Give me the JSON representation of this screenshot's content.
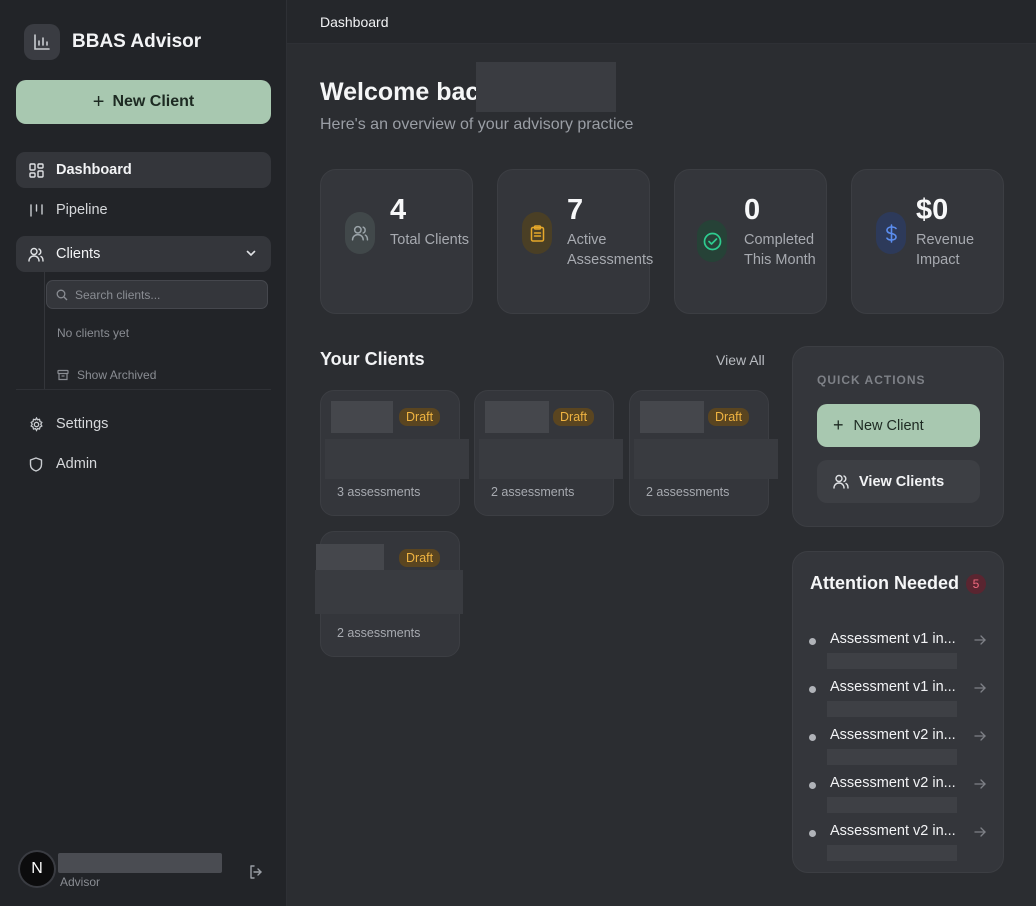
{
  "app": {
    "name": "BBAS Advisor"
  },
  "sidebar": {
    "new_client_label": "New Client",
    "nav": {
      "dashboard": "Dashboard",
      "pipeline": "Pipeline",
      "clients": "Clients",
      "settings": "Settings",
      "admin": "Admin"
    },
    "clients_panel": {
      "search_placeholder": "Search clients...",
      "empty_text": "No clients yet",
      "show_archived": "Show Archived"
    },
    "user": {
      "avatar_initial": "N",
      "role": "Advisor"
    }
  },
  "topbar": {
    "title": "Dashboard"
  },
  "main": {
    "welcome": "Welcome bac",
    "subtitle": "Here's an overview of your advisory practice",
    "stats": [
      {
        "value": "4",
        "label": "Total Clients",
        "icon": "users-icon",
        "color": "#9aa3a8"
      },
      {
        "value": "7",
        "label": "Active Assessments",
        "icon": "clipboard-icon",
        "color": "#e6a82a"
      },
      {
        "value": "0",
        "label": "Completed This Month",
        "icon": "check-circle-icon",
        "color": "#2ecc8f"
      },
      {
        "value": "$0",
        "label": "Revenue Impact",
        "icon": "dollar-icon",
        "color": "#5b8def"
      }
    ],
    "clients_section": {
      "title": "Your Clients",
      "view_all": "View All",
      "cards": [
        {
          "status": "Draft",
          "assessments": "3 assessments"
        },
        {
          "status": "Draft",
          "assessments": "2 assessments"
        },
        {
          "status": "Draft",
          "assessments": "2 assessments"
        },
        {
          "status": "Draft",
          "assessments": "2 assessments"
        }
      ]
    },
    "quick_actions": {
      "title": "QUICK ACTIONS",
      "new_client": "New Client",
      "view_clients": "View Clients"
    },
    "attention": {
      "title": "Attention Needed",
      "count": "5",
      "items": [
        "Assessment v1 in...",
        "Assessment v1 in...",
        "Assessment v2 in...",
        "Assessment v2 in...",
        "Assessment v2 in..."
      ]
    }
  },
  "colors": {
    "accent": "#a8c8b0",
    "draft_badge": "#f0b441",
    "attention_badge": "#f06a7e"
  }
}
